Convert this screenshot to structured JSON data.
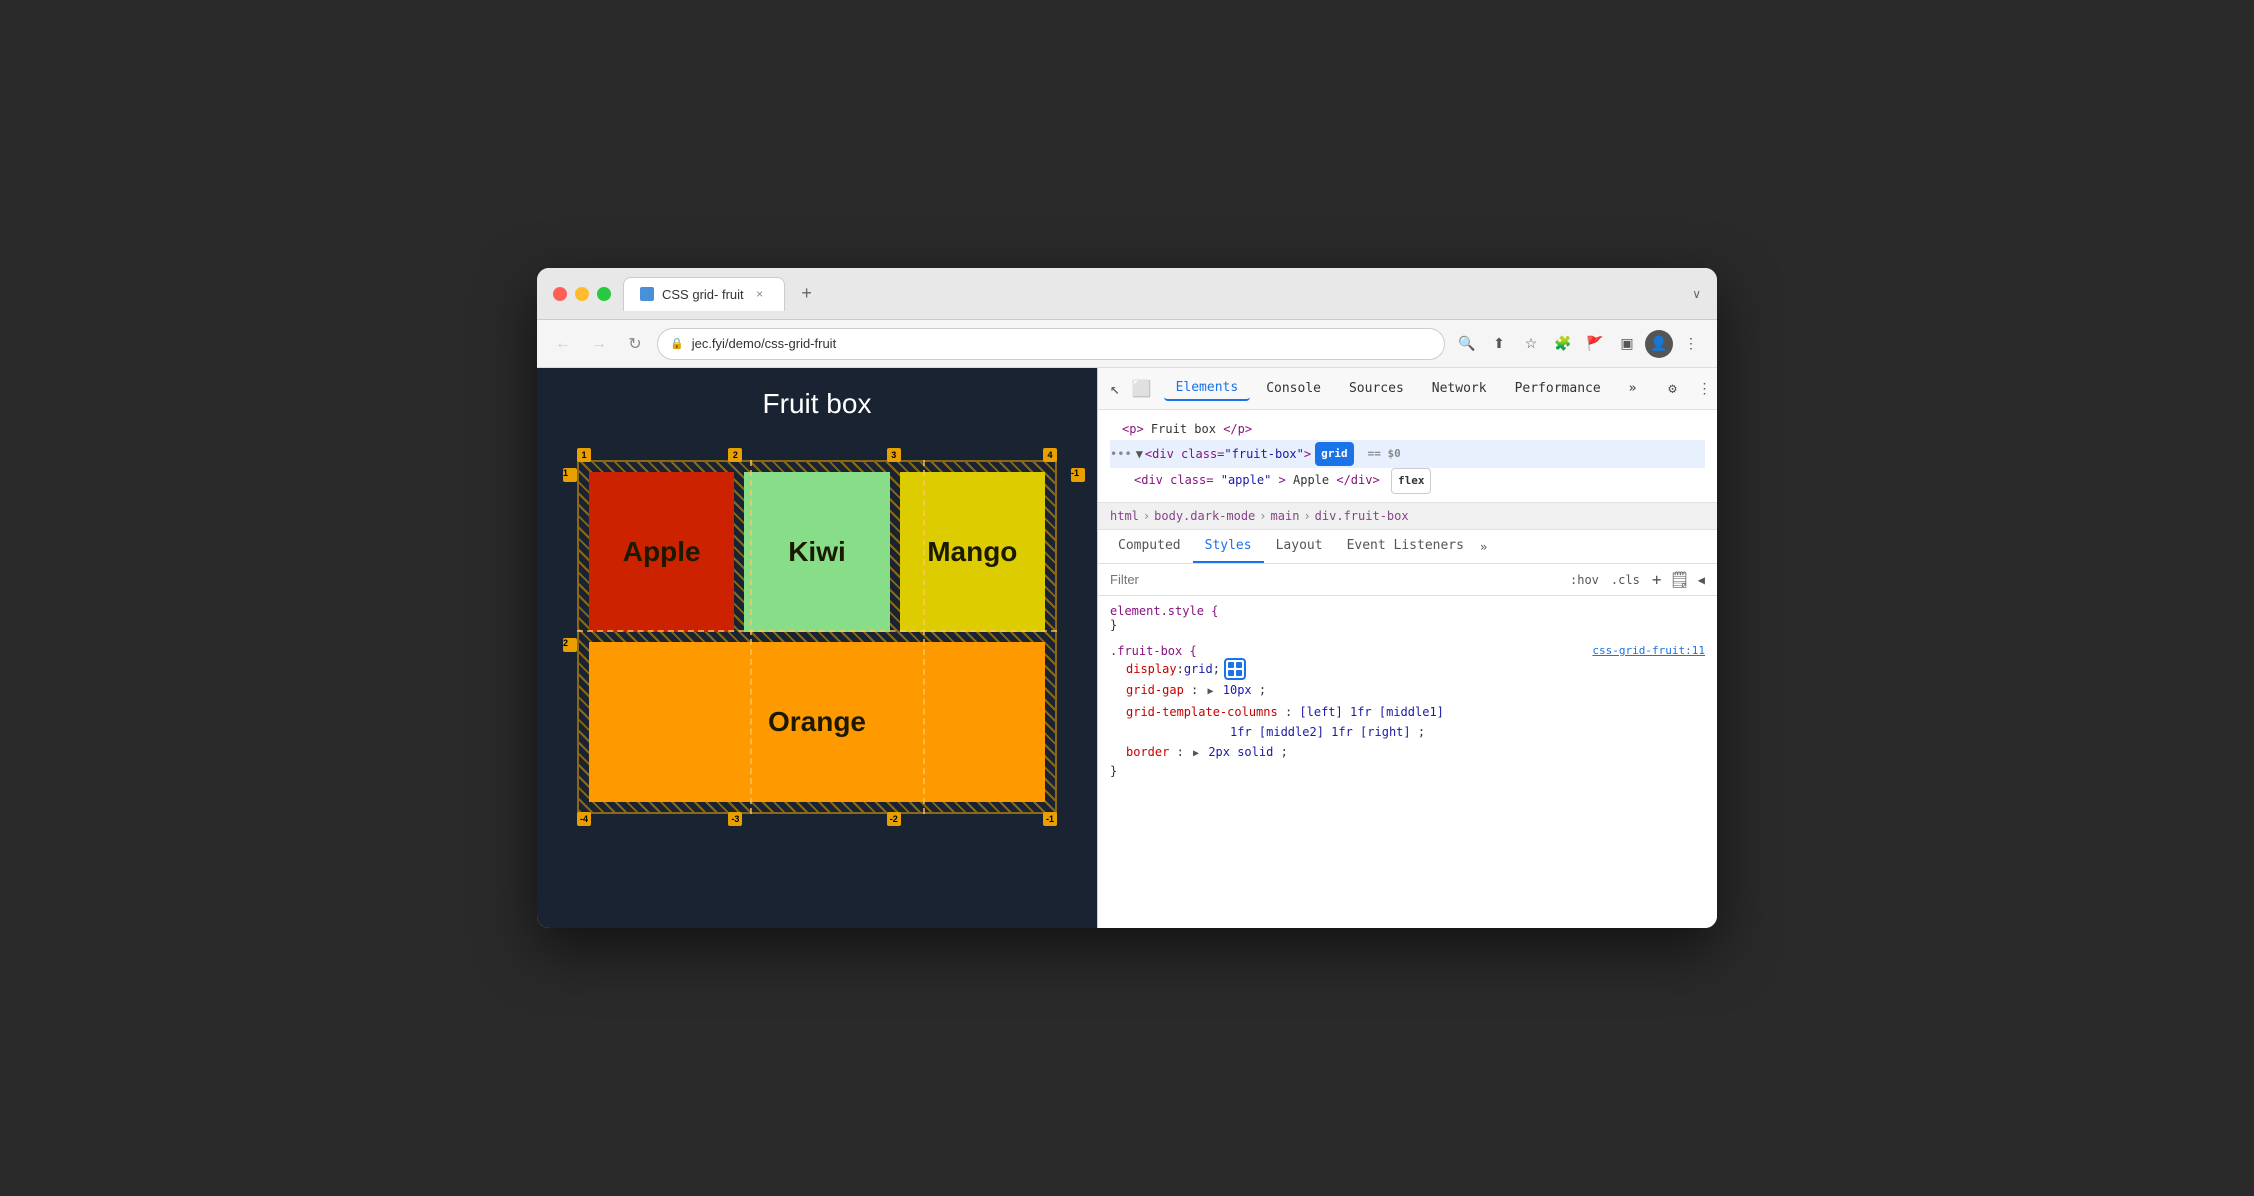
{
  "browser": {
    "traffic_lights": [
      "close",
      "minimize",
      "maximize"
    ],
    "tab": {
      "label": "CSS grid- fruit",
      "close": "×"
    },
    "tab_new": "+",
    "chevron": "∨",
    "nav": {
      "back": "←",
      "forward": "→",
      "refresh": "↻"
    },
    "url": "jec.fyi/demo/css-grid-fruit",
    "toolbar_icons": [
      "zoom",
      "share",
      "star",
      "extension",
      "extension2",
      "screenshot",
      "profile",
      "menu"
    ]
  },
  "webpage": {
    "title": "Fruit box",
    "fruits": [
      {
        "name": "Apple",
        "class": "apple"
      },
      {
        "name": "Kiwi",
        "class": "kiwi"
      },
      {
        "name": "Mango",
        "class": "mango"
      },
      {
        "name": "Orange",
        "class": "orange"
      }
    ]
  },
  "devtools": {
    "main_tabs": [
      "Elements",
      "Console",
      "Sources",
      "Network",
      "Performance"
    ],
    "active_main_tab": "Elements",
    "more_tabs": "»",
    "icons": {
      "pointer": "↖",
      "inspect": "⬜",
      "settings": "⚙",
      "more": "⋮",
      "close": "×"
    },
    "dom": {
      "line1": "<p>Fruit box</p>",
      "line2_pre": "<div class=\"fruit-box\">",
      "line2_badge": "grid",
      "line2_dollar": "== $0",
      "line3_pre": "<div class=\"apple\">Apple</div>",
      "line3_badge": "flex"
    },
    "breadcrumb": [
      "html",
      "body.dark-mode",
      "main",
      "div.fruit-box"
    ],
    "subtabs": [
      "Computed",
      "Styles",
      "Layout",
      "Event Listeners"
    ],
    "active_subtab": "Styles",
    "more_subtabs": "»",
    "filter": {
      "placeholder": "Filter",
      "hov": ":hov",
      "cls": ".cls",
      "plus": "+",
      "copy_icon": "📋",
      "arrow_icon": "◀"
    },
    "css_rules": [
      {
        "selector": "element.style {",
        "close": "}",
        "properties": []
      },
      {
        "selector": ".fruit-box {",
        "source": "css-grid-fruit:11",
        "close": "}",
        "properties": [
          {
            "prop": "display",
            "colon": ": ",
            "value": "grid",
            "semi": ";",
            "has_icon": true
          },
          {
            "prop": "grid-gap",
            "colon": ": ",
            "triangle": "▶",
            "value": "10px",
            "semi": ";"
          },
          {
            "prop": "grid-template-columns",
            "colon": ": ",
            "value": "[left] 1fr [middle1]",
            "semi": ""
          },
          {
            "prop": "",
            "colon": "",
            "value": "1fr [middle2] 1fr [right]",
            "semi": ";"
          },
          {
            "prop": "border",
            "colon": ": ",
            "triangle": "▶",
            "value": "2px solid",
            "semi": ";"
          }
        ]
      }
    ]
  }
}
